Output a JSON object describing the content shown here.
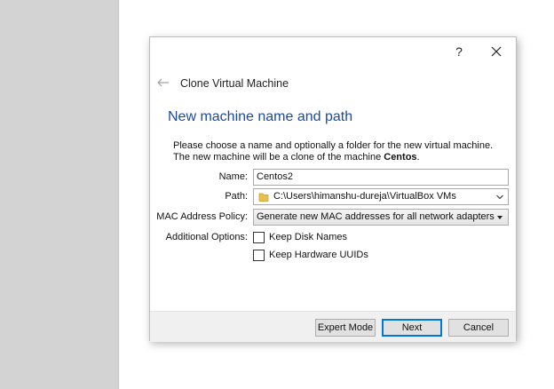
{
  "dialog": {
    "help_label": "?",
    "wizard_title": "Clone Virtual Machine",
    "page_title": "New machine name and path",
    "description": "Please choose a name and optionally a folder for the new virtual machine. The new machine will be a clone of the machine ",
    "source_machine": "Centos",
    "description_end": ".",
    "name": {
      "label": "Name:",
      "value": "Centos2"
    },
    "path": {
      "label": "Path:",
      "value": "C:\\Users\\himanshu-dureja\\VirtualBox VMs"
    },
    "mac_policy": {
      "label": "MAC Address Policy:",
      "value": "Generate new MAC addresses for all network adapters"
    },
    "additional_options": {
      "label": "Additional Options:",
      "keep_disk_names": {
        "label": "Keep Disk Names",
        "checked": false
      },
      "keep_hardware_uuids": {
        "label": "Keep Hardware UUIDs",
        "checked": false
      }
    },
    "buttons": {
      "expert_mode": "Expert Mode",
      "next": "Next",
      "cancel": "Cancel"
    }
  },
  "colors": {
    "left_panel": "#d3d3d3",
    "page_title": "#1b4aa5",
    "default_button_border": "#0078d7",
    "folder_icon": "#e8bf4f"
  },
  "icons": [
    "back-arrow-icon",
    "help-icon",
    "close-icon",
    "folder-icon",
    "chevron-down-icon",
    "dropdown-arrow-icon"
  ]
}
